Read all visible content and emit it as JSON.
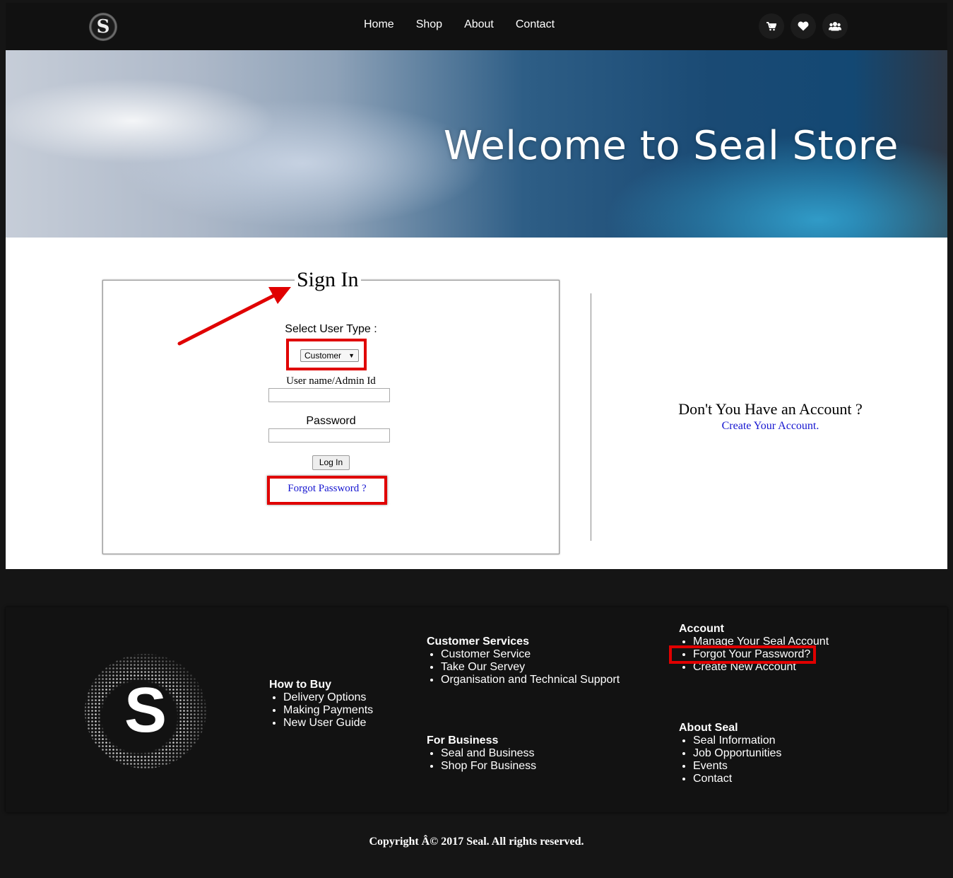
{
  "nav": {
    "logo_letter": "S",
    "links": [
      "Home",
      "Shop",
      "About",
      "Contact"
    ],
    "icons": [
      "cart-icon",
      "heart-icon",
      "users-icon"
    ]
  },
  "hero": {
    "title": "Welcome to Seal Store"
  },
  "signin": {
    "legend": "Sign In",
    "user_type_label": "Select User Type :",
    "user_type_value": "Customer",
    "username_label": "User name/Admin Id",
    "username_value": "",
    "password_label": "Password",
    "password_value": "",
    "login_button": "Log In",
    "forgot_link": "Forgot Password ?"
  },
  "register": {
    "question": "Don't You Have an Account ?",
    "create_link": "Create Your Account."
  },
  "footer": {
    "logo_letter": "S",
    "how_to_buy": {
      "title": "How to Buy",
      "items": [
        "Delivery Options",
        "Making Payments",
        "New User Guide"
      ]
    },
    "customer_services": {
      "title": "Customer Services",
      "items": [
        "Customer Service",
        "Take Our Servey",
        "Organisation and Technical Support"
      ]
    },
    "for_business": {
      "title": "For Business",
      "items": [
        "Seal and Business",
        "Shop For Business"
      ]
    },
    "account": {
      "title": "Account",
      "items": [
        "Manage Your Seal Account",
        "Forgot Your Password?",
        "Create New Account"
      ]
    },
    "about_seal": {
      "title": "About Seal",
      "items": [
        "Seal Information",
        "Job Opportunities",
        "Events",
        "Contact"
      ]
    },
    "copyright": "Copyright Â© 2017 Seal. All rights reserved."
  },
  "colors": {
    "annotation": "#e00000",
    "link": "#1515d0",
    "background": "#151515"
  }
}
